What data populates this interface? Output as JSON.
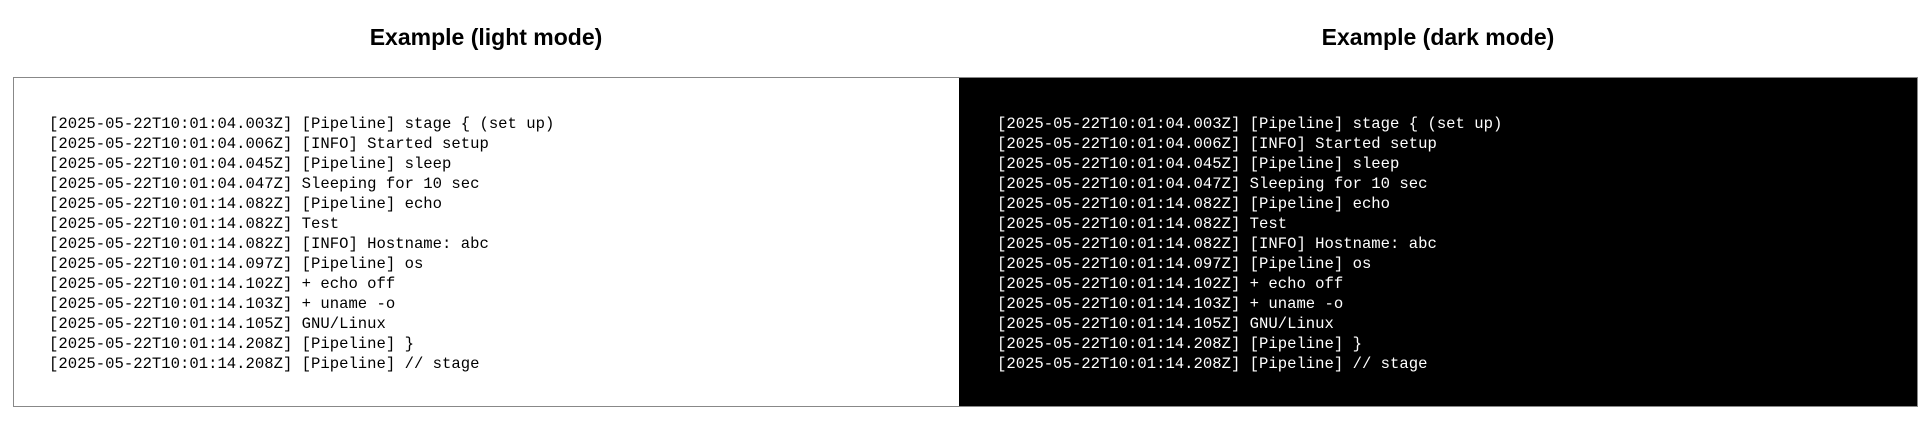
{
  "light": {
    "title": "Example (light mode)",
    "background": "#ffffff",
    "text_color": "#000000"
  },
  "dark": {
    "title": "Example (dark mode)",
    "background": "#000000",
    "text_color": "#ffffff"
  },
  "log_lines": [
    "[2025-05-22T10:01:04.003Z] [Pipeline] stage { (set up)",
    "[2025-05-22T10:01:04.006Z] [INFO] Started setup",
    "[2025-05-22T10:01:04.045Z] [Pipeline] sleep",
    "[2025-05-22T10:01:04.047Z] Sleeping for 10 sec",
    "[2025-05-22T10:01:14.082Z] [Pipeline] echo",
    "[2025-05-22T10:01:14.082Z] Test",
    "[2025-05-22T10:01:14.082Z] [INFO] Hostname: abc",
    "[2025-05-22T10:01:14.097Z] [Pipeline] os",
    "[2025-05-22T10:01:14.102Z] + echo off",
    "[2025-05-22T10:01:14.103Z] + uname -o",
    "[2025-05-22T10:01:14.105Z] GNU/Linux",
    "[2025-05-22T10:01:14.208Z] [Pipeline] }",
    "[2025-05-22T10:01:14.208Z] [Pipeline] // stage"
  ]
}
